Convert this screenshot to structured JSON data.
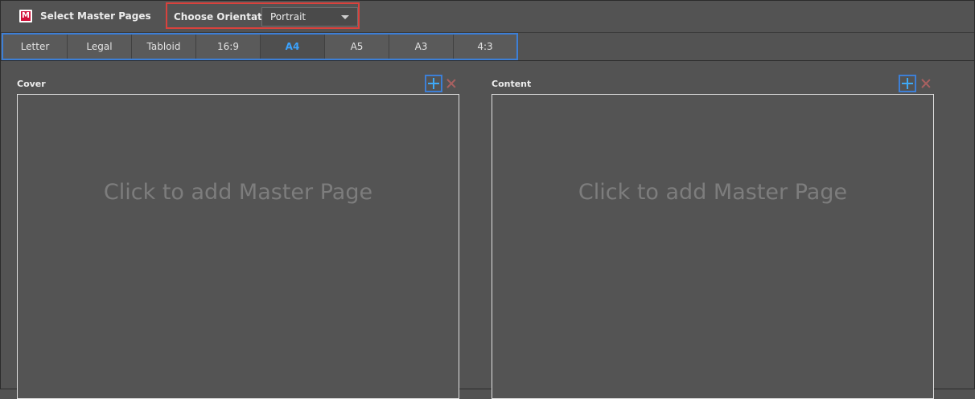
{
  "header": {
    "logo_letter": "M",
    "title": "Select Master Pages",
    "orientation_label": "Choose Orientation",
    "orientation_value": "Portrait"
  },
  "tabs": [
    {
      "label": "Letter"
    },
    {
      "label": "Legal"
    },
    {
      "label": "Tabloid"
    },
    {
      "label": "16:9"
    },
    {
      "label": "A4"
    },
    {
      "label": "A5"
    },
    {
      "label": "A3"
    },
    {
      "label": "4:3"
    }
  ],
  "active_tab": "A4",
  "panels": {
    "cover": {
      "label": "Cover",
      "placeholder": "Click to add Master Page"
    },
    "content": {
      "label": "Content",
      "placeholder": "Click to add Master Page"
    }
  },
  "colors": {
    "background": "#535353",
    "accent": "#3ba3ff",
    "highlight_red": "#d9423d",
    "highlight_blue": "#3d7fd6",
    "logo": "#d2113a"
  }
}
